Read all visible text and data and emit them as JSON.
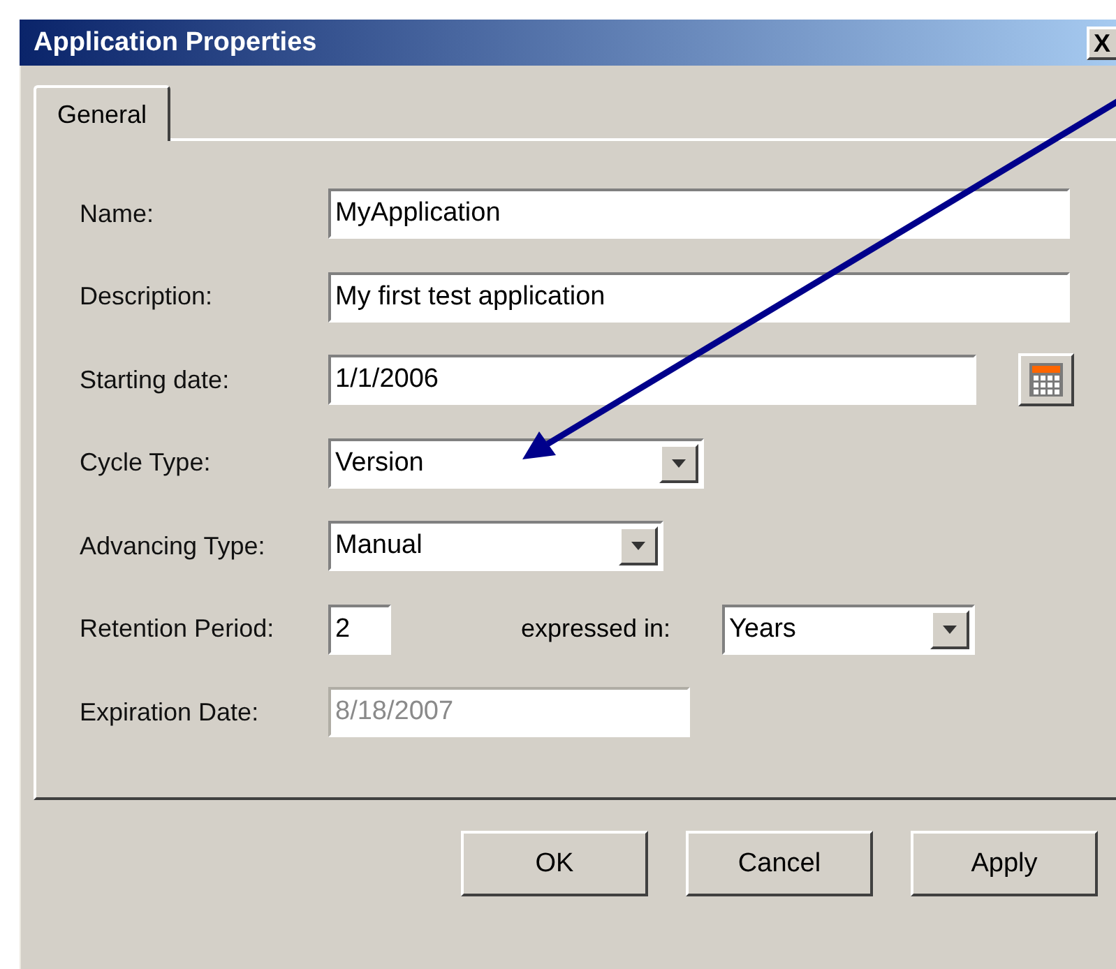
{
  "window": {
    "title": "Application Properties",
    "close_glyph": "X"
  },
  "tabs": [
    {
      "label": "General",
      "selected": true
    }
  ],
  "fields": [
    {
      "label": "Name:",
      "kind": "text",
      "value": "MyApplication",
      "disabled": false
    },
    {
      "label": "Description:",
      "kind": "text",
      "value": "My first test application",
      "disabled": false
    },
    {
      "label": "Starting date:",
      "kind": "date",
      "value": "1/1/2006",
      "disabled": false
    },
    {
      "label": "Cycle Type:",
      "kind": "dropdown",
      "value": "Version",
      "disabled": false
    },
    {
      "label": "Advancing Type:",
      "kind": "dropdown",
      "value": "Manual",
      "disabled": false
    },
    {
      "label": "Retention Period:",
      "kind": "period",
      "value": "2",
      "unit_label": "expressed in:",
      "unit": "Years",
      "disabled": false
    },
    {
      "label": "Expiration Date:",
      "kind": "text",
      "value": "8/18/2007",
      "disabled": true
    }
  ],
  "buttons": [
    "OK",
    "Cancel",
    "Apply"
  ]
}
